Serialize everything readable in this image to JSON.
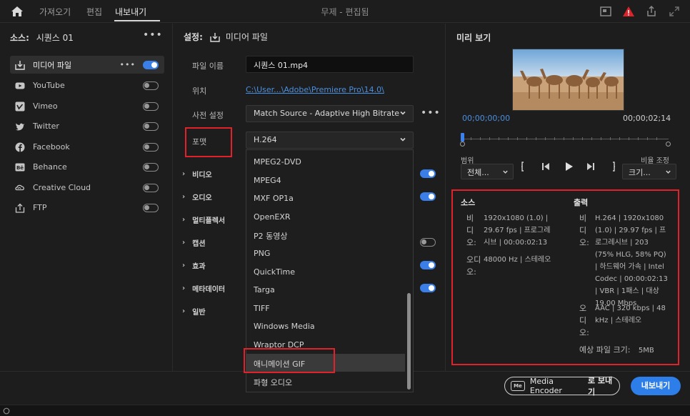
{
  "topbar": {
    "tabs": [
      "가져오기",
      "편집",
      "내보내기"
    ],
    "title": "무제 - 편집됨"
  },
  "source": {
    "label": "소스:",
    "value": "시퀀스 01"
  },
  "destinations": [
    {
      "label": "미디어 파일",
      "icon": "media-file-icon",
      "enabled": true
    },
    {
      "label": "YouTube",
      "icon": "youtube-icon",
      "enabled": false
    },
    {
      "label": "Vimeo",
      "icon": "vimeo-icon",
      "enabled": false
    },
    {
      "label": "Twitter",
      "icon": "twitter-icon",
      "enabled": false
    },
    {
      "label": "Facebook",
      "icon": "facebook-icon",
      "enabled": false
    },
    {
      "label": "Behance",
      "icon": "behance-icon",
      "enabled": false
    },
    {
      "label": "Creative Cloud",
      "icon": "creative-cloud-icon",
      "enabled": false
    },
    {
      "label": "FTP",
      "icon": "ftp-icon",
      "enabled": false
    }
  ],
  "settings": {
    "head": "설정:",
    "head_target": "미디어 파일",
    "filename_label": "파일 이름",
    "filename_value": "시퀀스 01.mp4",
    "location_label": "위치",
    "location_value": "C:\\User...\\Adobe\\Premiere Pro\\14.0\\",
    "preset_label": "사전 설정",
    "preset_value": "Match Source - Adaptive High Bitrate",
    "format_label": "포맷",
    "format_value": "H.264"
  },
  "sections": [
    {
      "label": "비디오",
      "toggle": "on"
    },
    {
      "label": "오디오",
      "toggle": "on"
    },
    {
      "label": "멀티플렉서",
      "toggle": "none"
    },
    {
      "label": "캡션",
      "toggle": "off"
    },
    {
      "label": "효과",
      "toggle": "on"
    },
    {
      "label": "메타데이터",
      "toggle": "on"
    },
    {
      "label": "일반",
      "toggle": "none"
    }
  ],
  "format_options": [
    "MPEG2-DVD",
    "MPEG4",
    "MXF OP1a",
    "OpenEXR",
    "P2 동영상",
    "PNG",
    "QuickTime",
    "Targa",
    "TIFF",
    "Windows Media",
    "Wraptor DCP",
    "애니메이션 GIF",
    "파형 오디오"
  ],
  "highlighted_option": "애니메이션 GIF",
  "preview": {
    "title": "미리 보기",
    "timecode_start": "00;00;00;00",
    "timecode_end": "00;00;02;14",
    "range_label": "범위",
    "range_value": "전체...",
    "scale_label": "비율 조정",
    "scale_value": "크기..."
  },
  "info": {
    "source_head": "소스",
    "output_head": "출력",
    "source_video_key": "비디오:",
    "source_video": "1920x1080 (1.0) | 29.67 fps | 프로그레시브 | 00:00:02:13",
    "source_audio_key": "오디오:",
    "source_audio": "48000 Hz | 스테레오",
    "output_video_key": "비디오:",
    "output_video": "H.264 | 1920x1080 (1.0) | 29.97 fps | 프로그레시브 | 203 (75% HLG, 58% PQ) | 하드웨어 가속 | Intel Codec | 00:00:02:13 | VBR | 1패스 | 대상 19.00 Mbps",
    "output_audio_key": "오디오:",
    "output_audio": "AAC | 320 kbps | 48 kHz | 스테레오",
    "size_label": "예상 파일 크기:",
    "size_value": "5MB"
  },
  "footer": {
    "encoder_prefix": "Media Encoder",
    "encoder_suffix": "로 보내기",
    "export_label": "내보내기"
  },
  "colors": {
    "accent": "#2d7ee9",
    "highlight_box": "#e0222a",
    "link": "#4a8fe0"
  }
}
